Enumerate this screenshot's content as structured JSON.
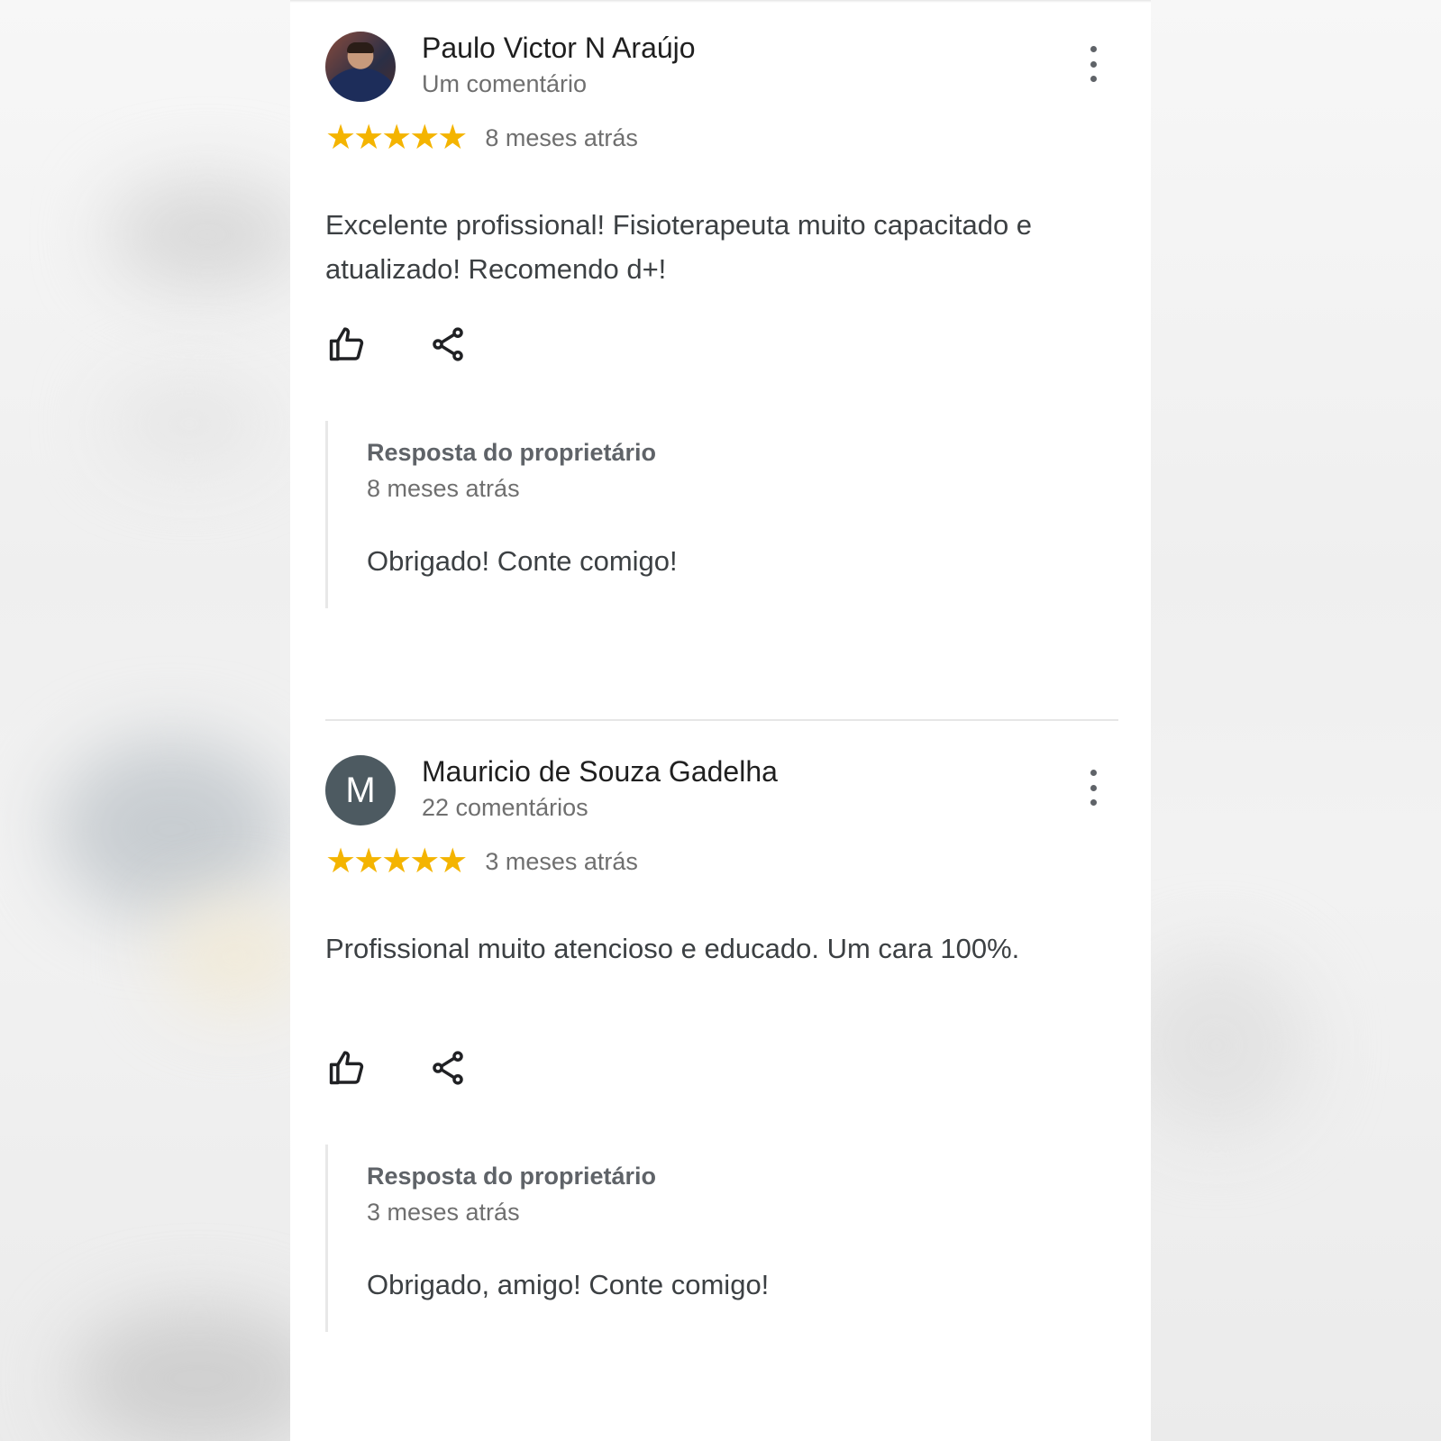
{
  "reviews": [
    {
      "reviewer_name": "Paulo Victor N Araújo",
      "review_count": "Um comentário",
      "avatar": "photo",
      "stars": "★★★★★",
      "rating": 5,
      "time": "8 meses atrás",
      "text": "Excelente profissional! Fisioterapeuta muito capacitado e atualizado! Recomendo d+!",
      "like_icon": "thumbs-up-icon",
      "share_icon": "share-icon",
      "menu_icon": "more-vert-icon",
      "reply": {
        "title": "Resposta do proprietário",
        "time": "8 meses atrás",
        "text": "Obrigado! Conte comigo!"
      }
    },
    {
      "reviewer_name": "Mauricio de Souza Gadelha",
      "review_count": "22 comentários",
      "avatar_letter": "M",
      "stars": "★★★★★",
      "rating": 5,
      "time": "3 meses atrás",
      "text": "Profissional muito atencioso e educado. Um cara 100%.",
      "like_icon": "thumbs-up-icon",
      "share_icon": "share-icon",
      "menu_icon": "more-vert-icon",
      "reply": {
        "title": "Resposta do proprietário",
        "time": "3 meses atrás",
        "text": "Obrigado, amigo! Conte comigo!"
      }
    }
  ],
  "colors": {
    "star": "#f4b400",
    "avatar_letter_bg": "#4d5a61",
    "text_primary": "#1f1f1f",
    "text_secondary": "#6f6f6f",
    "text_body": "#3c4043"
  }
}
